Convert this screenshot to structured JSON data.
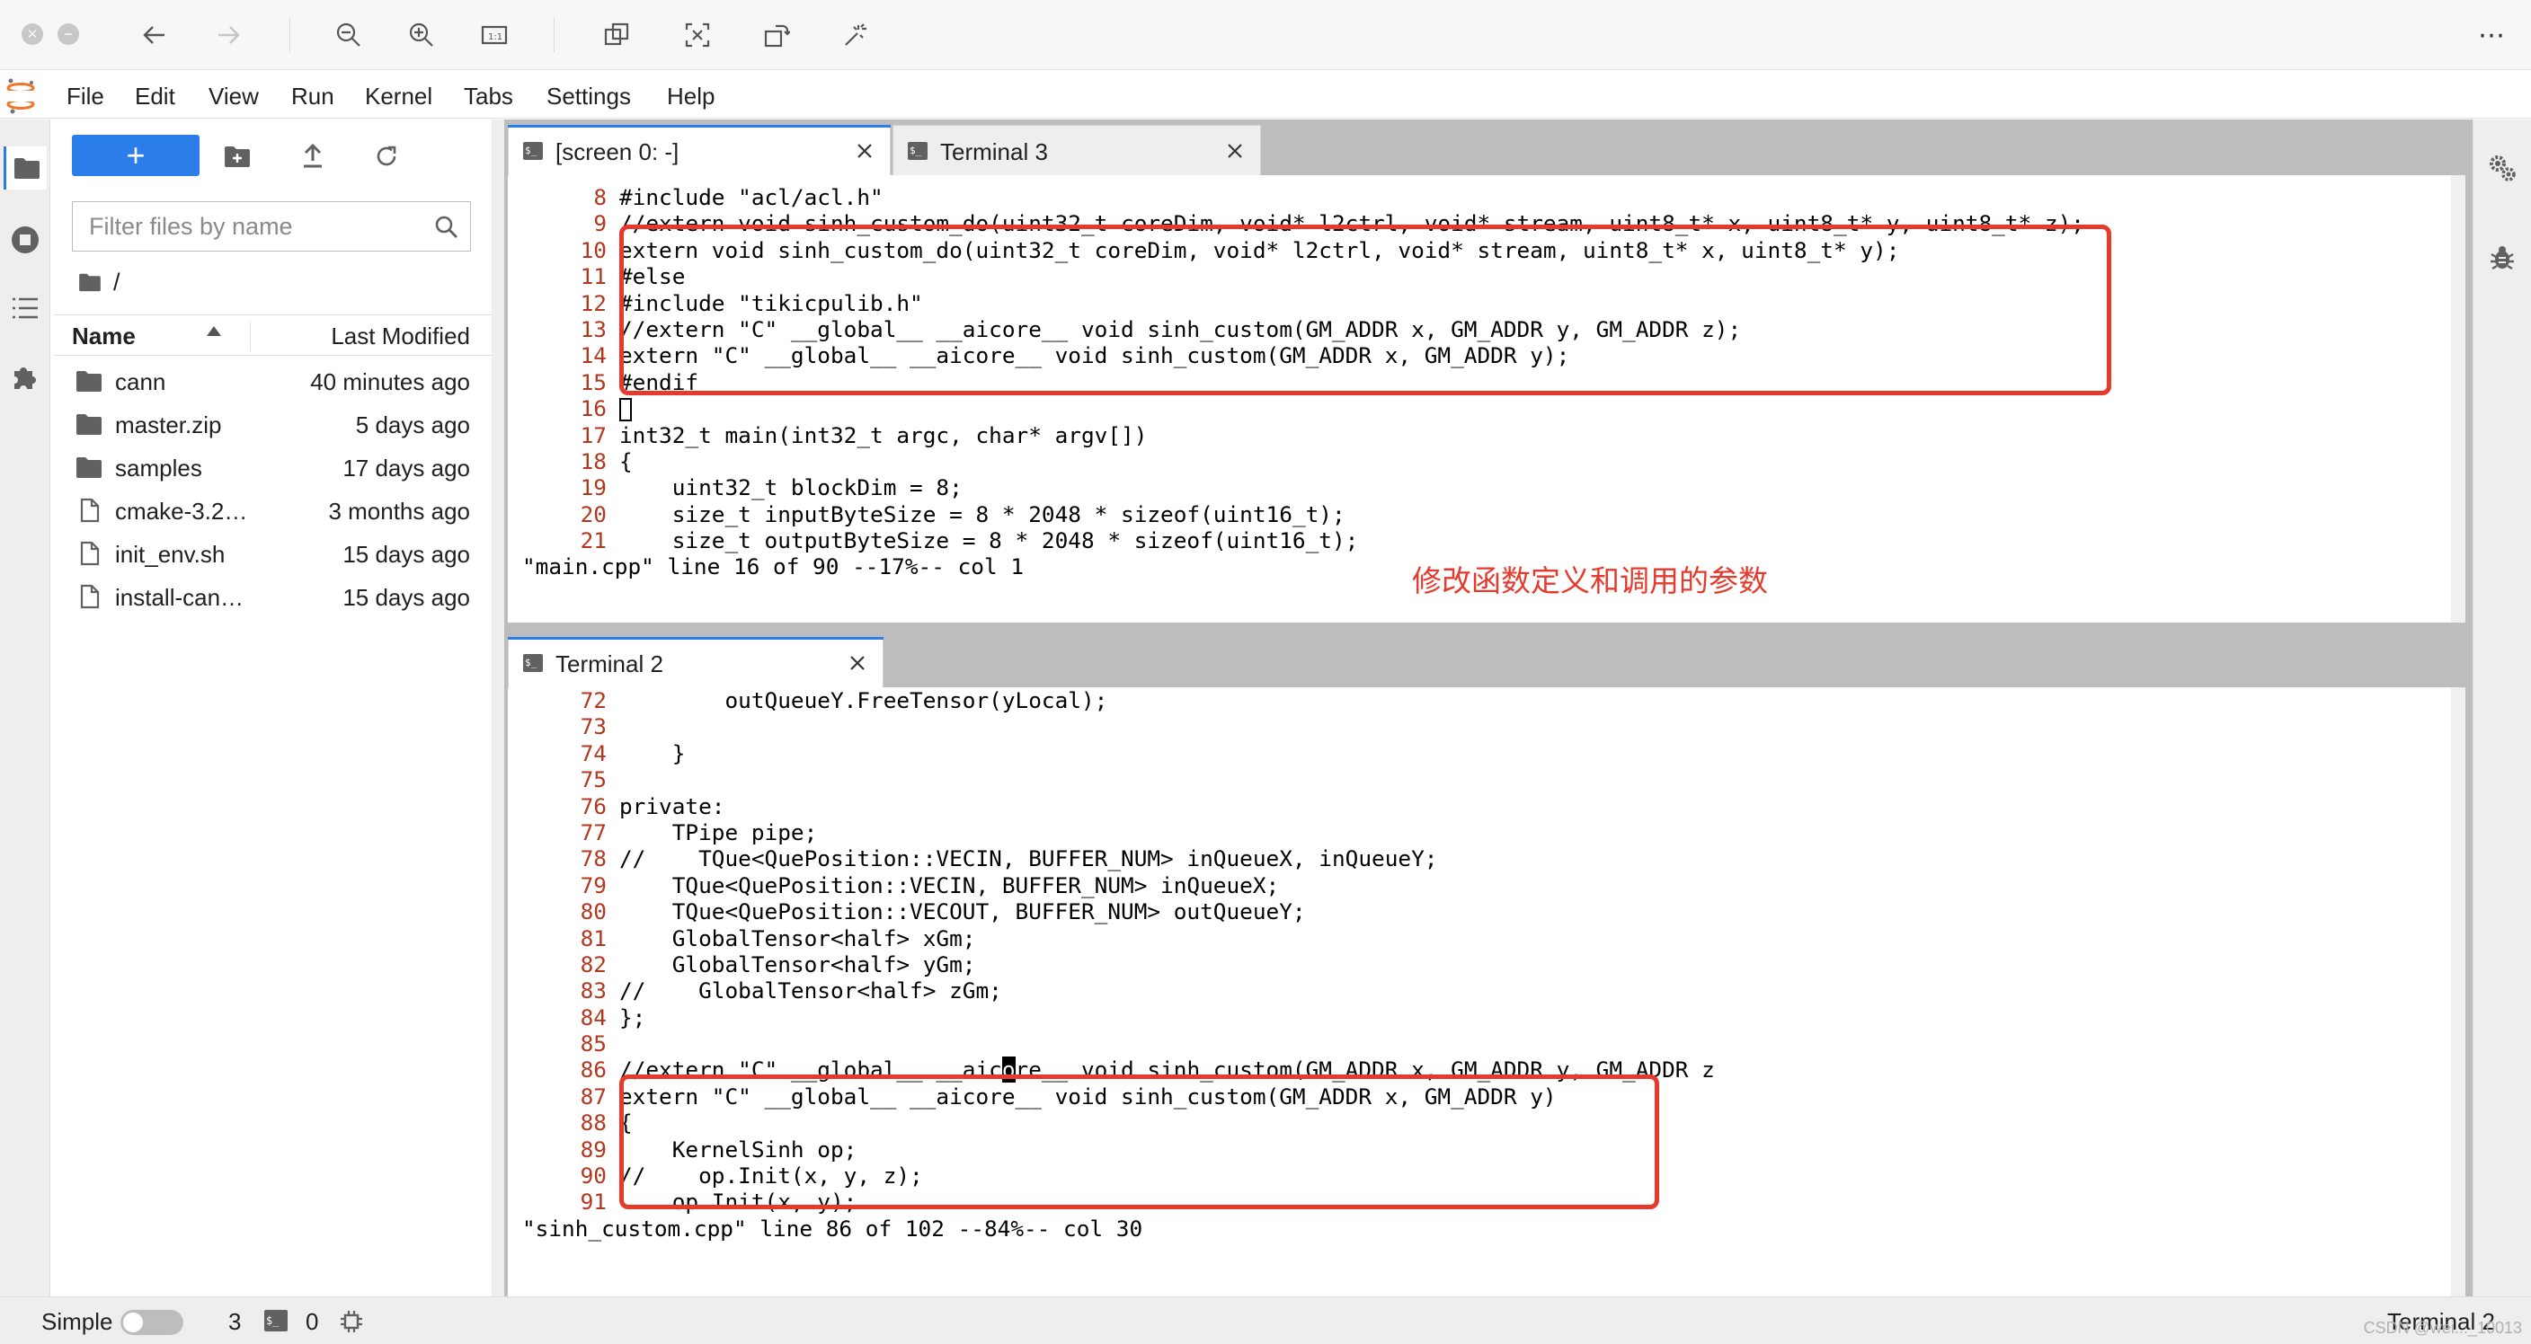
{
  "toolbar": {
    "icons": [
      "close-icon",
      "minimize-icon",
      "back-arrow-icon",
      "forward-arrow-icon",
      "zoom-out-icon",
      "zoom-in-icon",
      "actual-size-icon",
      "window-icon",
      "screenshot-icon",
      "rotate-icon",
      "magic-wand-icon",
      "more-icon"
    ],
    "more": "⋯"
  },
  "menubar": {
    "items": [
      "File",
      "Edit",
      "View",
      "Run",
      "Kernel",
      "Tabs",
      "Settings",
      "Help"
    ],
    "logo_color": "#f37626"
  },
  "filebrowser": {
    "new_button": "+",
    "filter_placeholder": "Filter files by name",
    "breadcrumb": "/",
    "col_name": "Name",
    "col_modified": "Last Modified",
    "rows": [
      {
        "name": "cann",
        "modified": "40 minutes ago",
        "type": "folder"
      },
      {
        "name": "master.zip",
        "modified": "5 days ago",
        "type": "folder"
      },
      {
        "name": "samples",
        "modified": "17 days ago",
        "type": "folder"
      },
      {
        "name": "cmake-3.2…",
        "modified": "3 months ago",
        "type": "file"
      },
      {
        "name": "init_env.sh",
        "modified": "15 days ago",
        "type": "file"
      },
      {
        "name": "install-can…",
        "modified": "15 days ago",
        "type": "file"
      }
    ]
  },
  "tabs_top": [
    {
      "label": "[screen 0: -]",
      "icon": "$_",
      "active": true
    },
    {
      "label": "Terminal 3",
      "icon": "$_",
      "active": false
    }
  ],
  "tabs_bottom": [
    {
      "label": "Terminal 2",
      "icon": "$_",
      "active": true
    }
  ],
  "terminal_top": {
    "lines": [
      {
        "n": "8",
        "t": "#include \"acl/acl.h\""
      },
      {
        "n": "9",
        "t": "//extern void sinh_custom_do(uint32_t coreDim, void* l2ctrl, void* stream, uint8_t* x, uint8_t* y, uint8_t* z);"
      },
      {
        "n": "10",
        "t": "extern void sinh_custom_do(uint32_t coreDim, void* l2ctrl, void* stream, uint8_t* x, uint8_t* y);"
      },
      {
        "n": "11",
        "t": "#else"
      },
      {
        "n": "12",
        "t": "#include \"tikicpulib.h\""
      },
      {
        "n": "13",
        "t": "//extern \"C\" __global__ __aicore__ void sinh_custom(GM_ADDR x, GM_ADDR y, GM_ADDR z);"
      },
      {
        "n": "14",
        "t": "extern \"C\" __global__ __aicore__ void sinh_custom(GM_ADDR x, GM_ADDR y);"
      },
      {
        "n": "15",
        "t": "#endif"
      },
      {
        "n": "16",
        "t": ""
      },
      {
        "n": "17",
        "t": "int32_t main(int32_t argc, char* argv[])"
      },
      {
        "n": "18",
        "t": "{"
      },
      {
        "n": "19",
        "t": "    uint32_t blockDim = 8;"
      },
      {
        "n": "20",
        "t": "    size_t inputByteSize = 8 * 2048 * sizeof(uint16_t);"
      },
      {
        "n": "21",
        "t": "    size_t outputByteSize = 8 * 2048 * sizeof(uint16_t);"
      }
    ],
    "status": "\"main.cpp\" line 16 of 90 --17%-- col 1",
    "annotation": "修改函数定义和调用的参数"
  },
  "terminal_bottom": {
    "lines": [
      {
        "n": "72",
        "t": "        outQueueY.FreeTensor(yLocal);"
      },
      {
        "n": "73",
        "t": ""
      },
      {
        "n": "74",
        "t": "    }"
      },
      {
        "n": "75",
        "t": ""
      },
      {
        "n": "76",
        "t": "private:"
      },
      {
        "n": "77",
        "t": "    TPipe pipe;"
      },
      {
        "n": "78",
        "t": "//    TQue<QuePosition::VECIN, BUFFER_NUM> inQueueX, inQueueY;"
      },
      {
        "n": "79",
        "t": "    TQue<QuePosition::VECIN, BUFFER_NUM> inQueueX;"
      },
      {
        "n": "80",
        "t": "    TQue<QuePosition::VECOUT, BUFFER_NUM> outQueueY;"
      },
      {
        "n": "81",
        "t": "    GlobalTensor<half> xGm;"
      },
      {
        "n": "82",
        "t": "    GlobalTensor<half> yGm;"
      },
      {
        "n": "83",
        "t": "//    GlobalTensor<half> zGm;"
      },
      {
        "n": "84",
        "t": "};"
      },
      {
        "n": "85",
        "t": ""
      },
      {
        "n": "86",
        "t": "//extern \"C\" __global__ __aicore__ void sinh_custom(GM_ADDR x, GM_ADDR y, GM_ADDR z"
      },
      {
        "n": "87",
        "t": "extern \"C\" __global__ __aicore__ void sinh_custom(GM_ADDR x, GM_ADDR y)"
      },
      {
        "n": "88",
        "t": "{"
      },
      {
        "n": "89",
        "t": "    KernelSinh op;"
      },
      {
        "n": "90",
        "t": "//    op.Init(x, y, z);"
      },
      {
        "n": "91",
        "t": "    op.Init(x, y);"
      }
    ],
    "status": "\"sinh_custom.cpp\" line 86 of 102 --84%-- col 30"
  },
  "statusbar": {
    "mode": "Simple",
    "terminals_count": "3",
    "kernels_count": "0",
    "right_label": "Terminal 2",
    "watermark": "CSDN @wei..._10013"
  }
}
